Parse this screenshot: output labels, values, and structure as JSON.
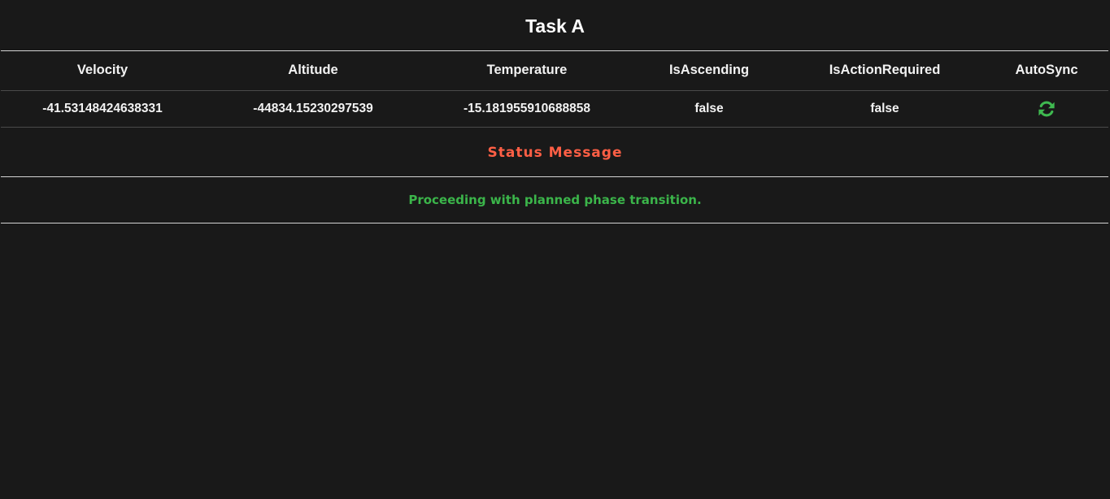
{
  "title": "Task A",
  "table": {
    "headers": [
      "Velocity",
      "Altitude",
      "Temperature",
      "IsAscending",
      "IsActionRequired",
      "AutoSync"
    ],
    "row": [
      "-41.53148424638331",
      "-44834.15230297539",
      "-15.181955910688858",
      "false",
      "false"
    ],
    "autosync_icon": "refresh-icon"
  },
  "status": {
    "label": "Status Message",
    "message": "Proceeding with planned phase transition."
  },
  "colors": {
    "background": "#191919",
    "status_label": "#ff5f45",
    "status_message": "#3bb54a",
    "sync_icon": "#3fb950"
  }
}
